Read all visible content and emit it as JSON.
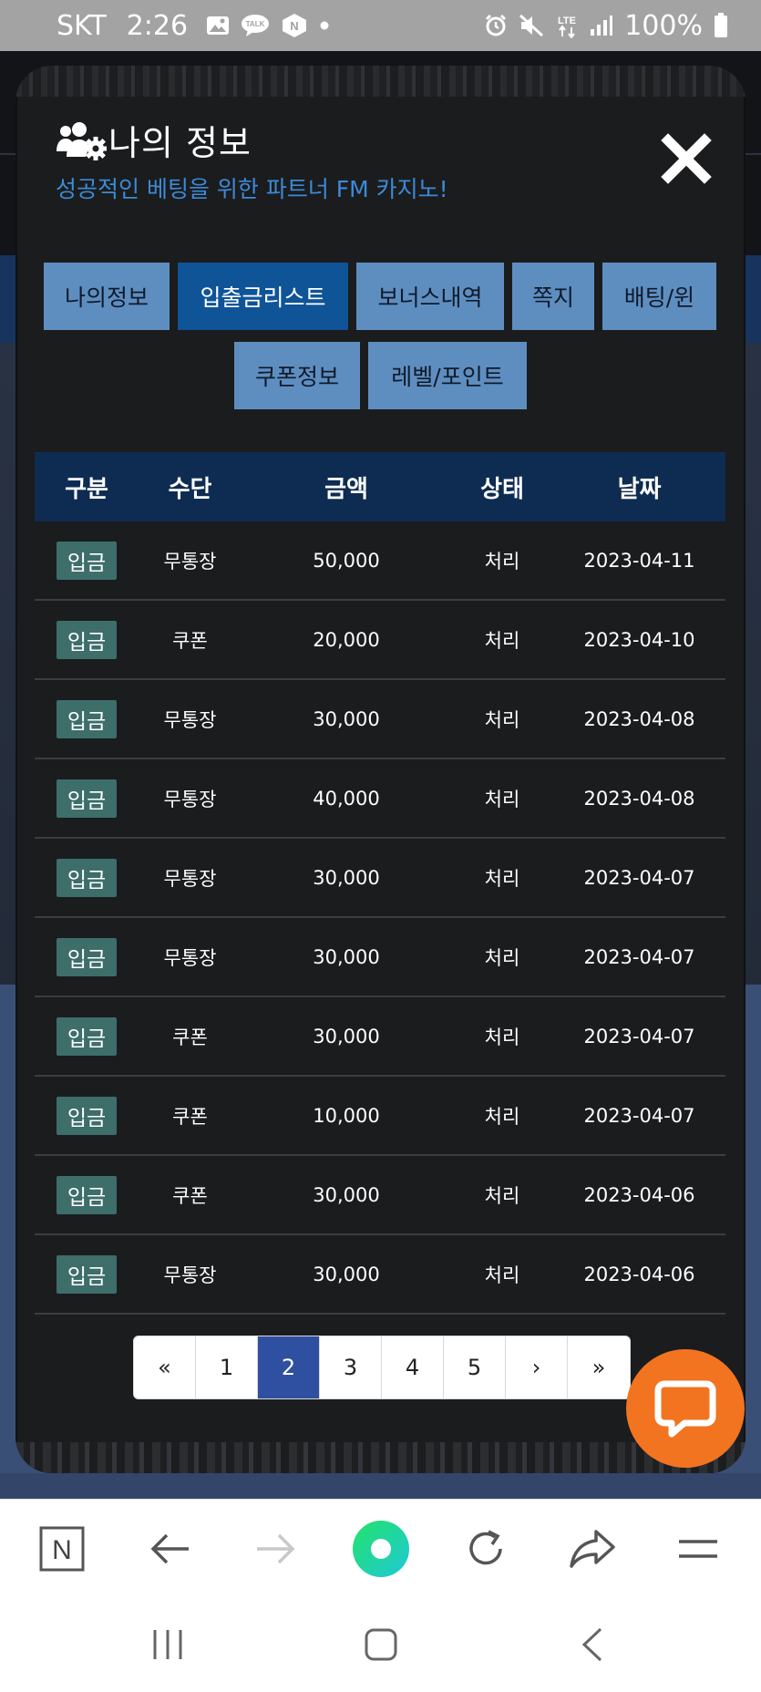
{
  "status_bar": {
    "carrier": "SKT",
    "time": "2:26",
    "battery": "100%",
    "left_icons": [
      "gallery-icon",
      "talk-icon",
      "naver-icon",
      "dot-icon"
    ],
    "right_icons": [
      "alarm-icon",
      "mute-icon",
      "lte-icon",
      "signal-icon",
      "battery-icon"
    ],
    "talk_label": "TALK",
    "naver_label": "N",
    "lte_label": "LTE"
  },
  "modal": {
    "title": "나의 정보",
    "subtitle": "성공적인 베팅을 위한 파트너 FM 카지노!",
    "title_icon": "users-gear-icon",
    "close_icon": "close-icon"
  },
  "tabs": [
    {
      "label": "나의정보",
      "active": false
    },
    {
      "label": "입출금리스트",
      "active": true
    },
    {
      "label": "보너스내역",
      "active": false
    },
    {
      "label": "쪽지",
      "active": false
    },
    {
      "label": "배팅/윈",
      "active": false
    },
    {
      "label": "쿠폰정보",
      "active": false
    },
    {
      "label": "레벨/포인트",
      "active": false
    }
  ],
  "table": {
    "headers": [
      "구분",
      "수단",
      "금액",
      "상태",
      "날짜"
    ],
    "rows": [
      [
        "입금",
        "무통장",
        "50,000",
        "처리",
        "2023-04-11"
      ],
      [
        "입금",
        "쿠폰",
        "20,000",
        "처리",
        "2023-04-10"
      ],
      [
        "입금",
        "무통장",
        "30,000",
        "처리",
        "2023-04-08"
      ],
      [
        "입금",
        "무통장",
        "40,000",
        "처리",
        "2023-04-08"
      ],
      [
        "입금",
        "무통장",
        "30,000",
        "처리",
        "2023-04-07"
      ],
      [
        "입금",
        "무통장",
        "30,000",
        "처리",
        "2023-04-07"
      ],
      [
        "입금",
        "쿠폰",
        "30,000",
        "처리",
        "2023-04-07"
      ],
      [
        "입금",
        "쿠폰",
        "10,000",
        "처리",
        "2023-04-07"
      ],
      [
        "입금",
        "쿠폰",
        "30,000",
        "처리",
        "2023-04-06"
      ],
      [
        "입금",
        "무통장",
        "30,000",
        "처리",
        "2023-04-06"
      ]
    ]
  },
  "pagination": {
    "items": [
      "«",
      "1",
      "2",
      "3",
      "4",
      "5",
      "›",
      "»"
    ],
    "active": "2"
  },
  "chat": {
    "icon": "chat-bubble-icon",
    "color": "#f27420"
  },
  "browser_toolbar": {
    "items": [
      "naver-home-icon",
      "back-icon",
      "forward-icon",
      "green-dot-icon",
      "refresh-icon",
      "share-icon",
      "menu-icon"
    ],
    "home_label": "N"
  },
  "system_nav": {
    "items": [
      "recent-apps-icon",
      "home-icon",
      "back-nav-icon"
    ]
  },
  "colors": {
    "accent": "#3c8ad7",
    "tab": "#5e8ec0",
    "tab_active": "#0f5497",
    "table_header": "#0e2c52",
    "badge": "#3d6e6a",
    "page_active": "#2f4fa0"
  }
}
